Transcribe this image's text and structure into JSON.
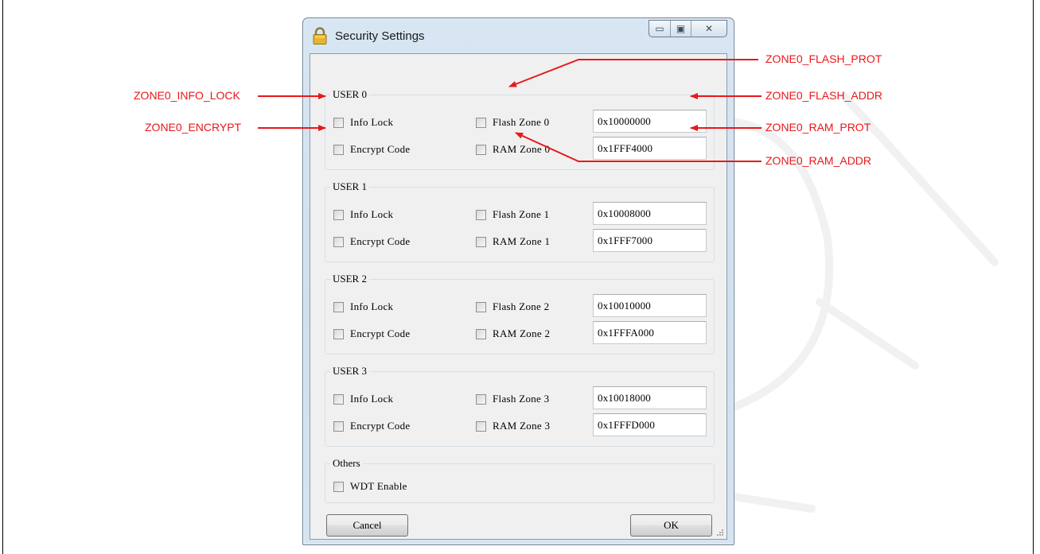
{
  "window": {
    "title": "Security Settings",
    "controls": {
      "minimize": "▭",
      "maximize": "▣",
      "close": "✕"
    }
  },
  "groups": [
    {
      "title": "USER 0",
      "rows": [
        {
          "left": "Info Lock",
          "mid": "Flash Zone 0",
          "addr": "0x10000000"
        },
        {
          "left": "Encrypt Code",
          "mid": "RAM Zone 0",
          "addr": "0x1FFF4000"
        }
      ]
    },
    {
      "title": "USER 1",
      "rows": [
        {
          "left": "Info Lock",
          "mid": "Flash Zone 1",
          "addr": "0x10008000"
        },
        {
          "left": "Encrypt Code",
          "mid": "RAM Zone 1",
          "addr": "0x1FFF7000"
        }
      ]
    },
    {
      "title": "USER 2",
      "rows": [
        {
          "left": "Info Lock",
          "mid": "Flash Zone 2",
          "addr": "0x10010000"
        },
        {
          "left": "Encrypt Code",
          "mid": "RAM Zone 2",
          "addr": "0x1FFFA000"
        }
      ]
    },
    {
      "title": "USER 3",
      "rows": [
        {
          "left": "Info Lock",
          "mid": "Flash Zone 3",
          "addr": "0x10018000"
        },
        {
          "left": "Encrypt Code",
          "mid": "RAM Zone 3",
          "addr": "0x1FFFD000"
        }
      ]
    }
  ],
  "others": {
    "title": "Others",
    "wdt_label": "WDT Enable"
  },
  "buttons": {
    "cancel": "Cancel",
    "ok": "OK"
  },
  "annotations": {
    "info_lock": "ZONE0_INFO_LOCK",
    "encrypt": "ZONE0_ENCRYPT",
    "flash_prot": "ZONE0_FLASH_PROT",
    "flash_addr": "ZONE0_FLASH_ADDR",
    "ram_prot": "ZONE0_RAM_PROT",
    "ram_addr": "ZONE0_RAM_ADDR",
    "color": "#e8181b"
  },
  "icons": {
    "title": "padlock-icon"
  }
}
